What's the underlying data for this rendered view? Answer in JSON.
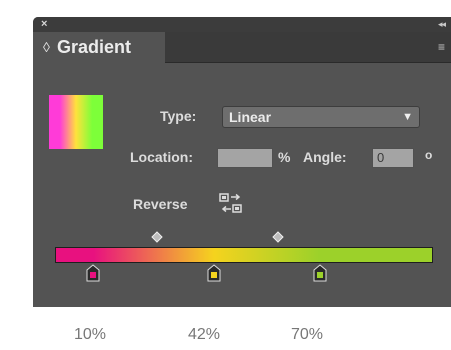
{
  "panel": {
    "close_glyph": "×",
    "collapse_glyph": "◂◂",
    "tab_chevron": "◊",
    "title": "Gradient",
    "menu_glyph": "≡",
    "icons": {
      "close": "close-icon",
      "collapse": "collapse-panel-icon",
      "tab_chevron": "panel-options-chevron-icon",
      "menu": "panel-menu-icon",
      "reverse": "reverse-gradient-icon",
      "dropdown": "chevron-down-icon"
    }
  },
  "controls": {
    "type_label": "Type:",
    "type_value": "Linear",
    "dropdown_arrow": "▼",
    "location_label": "Location:",
    "location_value": "",
    "location_unit": "%",
    "angle_label": "Angle:",
    "angle_value": "0",
    "angle_unit": "o",
    "reverse_label": "Reverse"
  },
  "gradient": {
    "stops": [
      {
        "location": 10,
        "color": "#e8117f"
      },
      {
        "location": 42,
        "color": "#f5d31e"
      },
      {
        "location": 70,
        "color": "#9cd12a"
      }
    ],
    "midpoints": [
      27,
      59
    ]
  },
  "percent_labels": [
    "10%",
    "42%",
    "70%"
  ],
  "colors": {
    "panel_bg": "#535353",
    "titlebar_bg": "#3c3c3c",
    "field_bg": "#a4a4a4"
  }
}
